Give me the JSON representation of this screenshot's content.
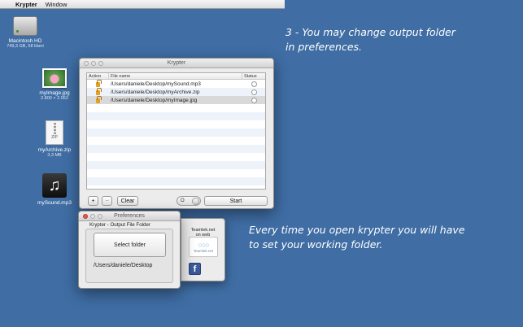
{
  "menubar": {
    "apple": "",
    "app": "Krypter",
    "window": "Window"
  },
  "desktop": {
    "hd": {
      "name": "Macintosh HD",
      "sub": "749,3 GB, 68 liberi"
    },
    "image": {
      "name": "myImage.jpg",
      "sub": "2.800 × 2.052"
    },
    "zip": {
      "name": "myArchive.zip",
      "sub": "3,3 MB",
      "badge": "ZIP"
    },
    "mp3": {
      "name": "mySound.mp3",
      "glyph": "♫"
    }
  },
  "captions": {
    "top_line1": "3 - You may change output folder",
    "top_line2": "in preferences.",
    "bottom_line1": "Every time you open krypter you will have",
    "bottom_line2": "to set your working folder."
  },
  "krypter": {
    "title": "Krypter",
    "columns": {
      "action": "Action",
      "name": "File name",
      "status": "Status"
    },
    "files": [
      {
        "name": "/Users/daniele/Desktop/mySound.mp3"
      },
      {
        "name": "/Users/daniele/Desktop/myArchive.zip"
      },
      {
        "name": "/Users/daniele/Desktop/myImage.jpg"
      }
    ],
    "buttons": {
      "add": "+",
      "remove": "−",
      "clear": "Clear",
      "toggle": "O",
      "start": "Start"
    }
  },
  "preferences": {
    "title": "Preferences",
    "group_label": "Krypter - Output File Folder",
    "select_button": "Select folder",
    "path": "/Users/daniele/Desktop",
    "side_line1": "Teamlek.net",
    "side_line2": "on web",
    "logo_text": "Teamlek.net",
    "facebook": "f"
  }
}
